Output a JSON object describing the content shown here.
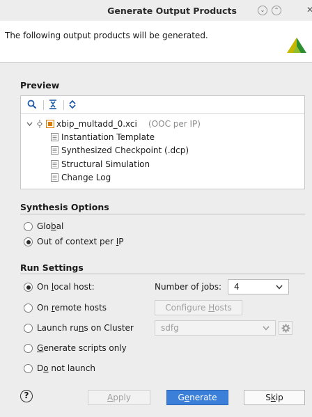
{
  "window": {
    "title": "Generate Output Products",
    "min_glyph": "⌄",
    "max_glyph": "⌃",
    "close_glyph": "✕"
  },
  "header": {
    "text": "The following output products will be generated."
  },
  "preview": {
    "title": "Preview",
    "ip_name": "xbip_multadd_0.xci",
    "ip_note": "(OOC per IP)",
    "items": [
      "Instantiation Template",
      "Synthesized Checkpoint (.dcp)",
      "Structural Simulation",
      "Change Log"
    ]
  },
  "synthesis": {
    "title": "Synthesis Options",
    "global_pre": "Glo",
    "global_key": "b",
    "global_post": "al",
    "ooc_pre": "Out of context per ",
    "ooc_key": "I",
    "ooc_post": "P",
    "selected": "ooc"
  },
  "run": {
    "title": "Run Settings",
    "local_pre": "On ",
    "local_key": "l",
    "local_post": "ocal host:",
    "jobs_pre": "Number of ",
    "jobs_key": "j",
    "jobs_post": "obs:",
    "jobs_value": "4",
    "remote_pre": "On ",
    "remote_key": "r",
    "remote_post": "emote hosts",
    "configure_pre": "Configure ",
    "configure_key": "H",
    "configure_post": "osts",
    "cluster_pre": "Launch ru",
    "cluster_key": "n",
    "cluster_post": "s on Cluster",
    "cluster_value": "sdfg",
    "scripts_pre": "",
    "scripts_key": "G",
    "scripts_post": "enerate scripts only",
    "nolaunch_pre": "D",
    "nolaunch_key": "o",
    "nolaunch_post": " not launch",
    "selected": "local"
  },
  "footer": {
    "help": "?",
    "apply_pre": "",
    "apply_key": "A",
    "apply_post": "pply",
    "generate_pre": "G",
    "generate_key": "e",
    "generate_post": "nerate",
    "skip_pre": "S",
    "skip_key": "k",
    "skip_post": "ip"
  },
  "colors": {
    "accent": "#3b7fd8",
    "logo_yellow": "#c6b700",
    "logo_green": "#2f8f2f"
  }
}
